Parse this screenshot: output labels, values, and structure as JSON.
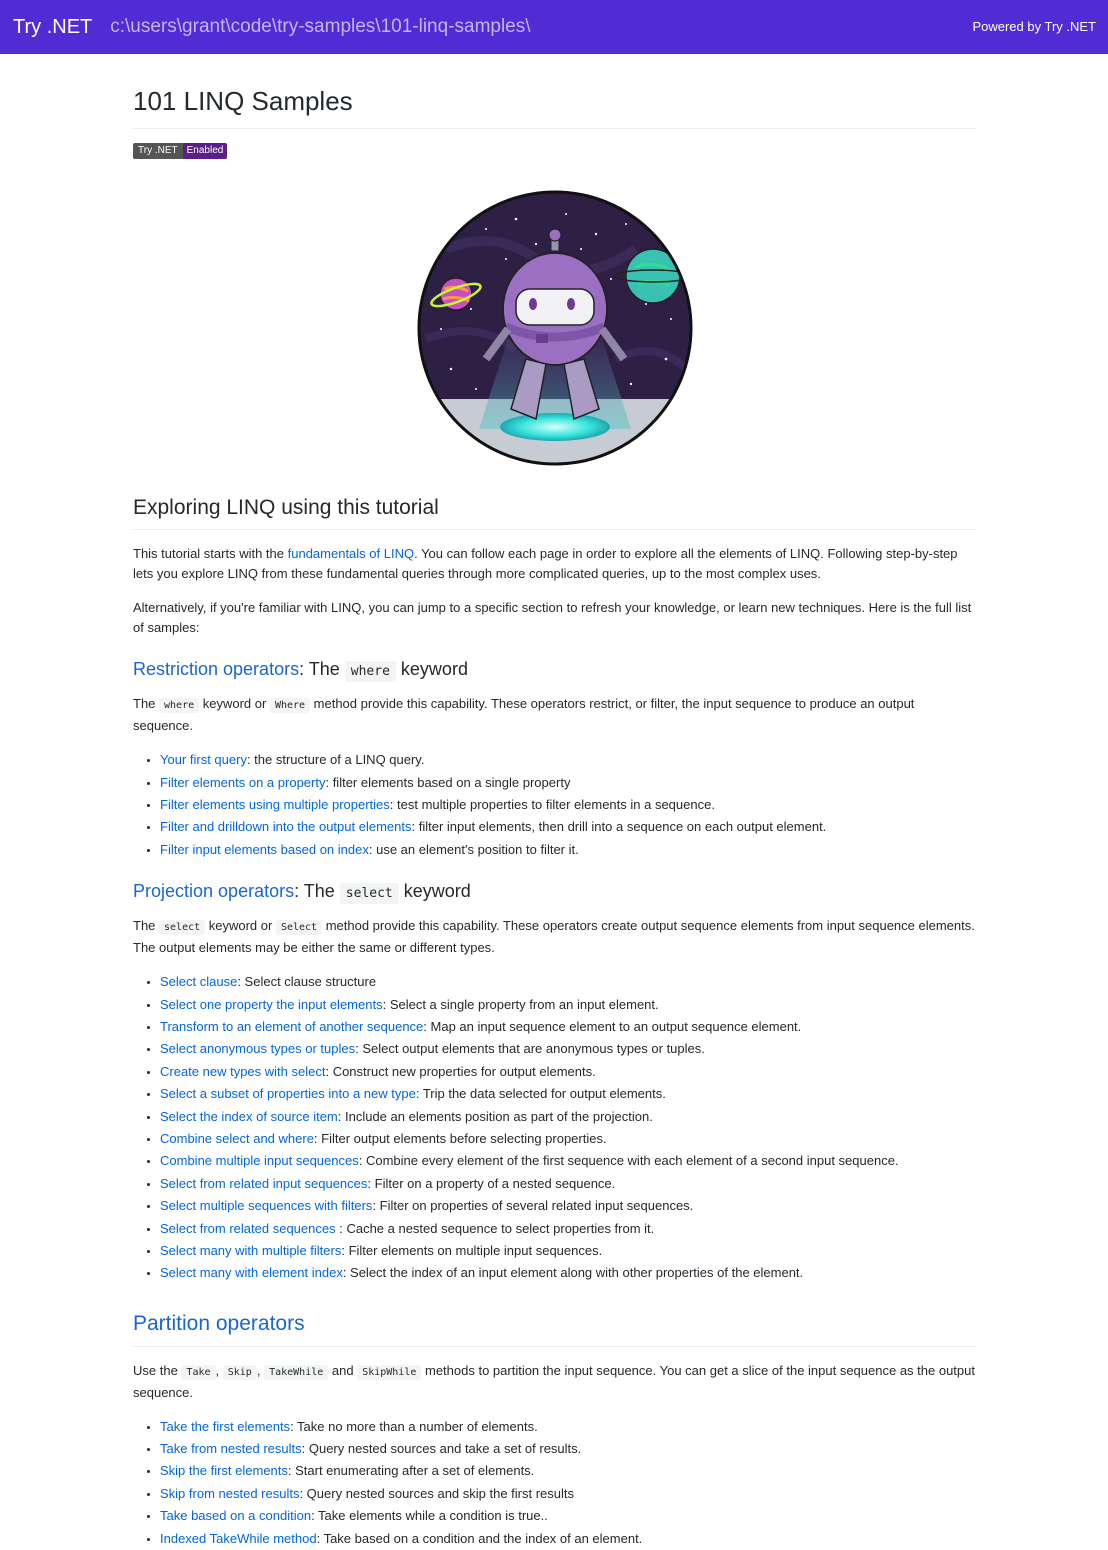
{
  "header": {
    "brand": "Try .NET",
    "path": "c:\\users\\grant\\code\\try-samples\\101-linq-samples\\",
    "powered_by": "Powered by Try .NET",
    "bg_color": "#512bd4"
  },
  "page": {
    "title": "101 LINQ Samples",
    "badge": {
      "left": "Try .NET",
      "right": "Enabled"
    },
    "hero_alt": "dotnet-bot astronaut"
  },
  "intro": {
    "heading": "Exploring LINQ using this tutorial",
    "p1_before": "This tutorial starts with the ",
    "p1_link": "fundamentals of LINQ",
    "p1_after": ". You can follow each page in order to explore all the elements of LINQ. Following step-by-step lets you explore LINQ from these fundamental queries through more complicated queries, up to the most complex uses.",
    "p2": "Alternatively, if you're familiar with LINQ, you can jump to a specific section to refresh your knowledge, or learn new techniques. Here is the full list of samples:"
  },
  "restriction": {
    "heading_link": "Restriction operators",
    "heading_mid": ": The ",
    "heading_code": "where",
    "heading_end": " keyword",
    "desc_1": "The ",
    "desc_code1": "where",
    "desc_2": " keyword or ",
    "desc_code2": "Where",
    "desc_3": " method provide this capability. These operators restrict, or filter, the input sequence to produce an output sequence.",
    "items": [
      {
        "link": "Your first query",
        "text": ": the structure of a LINQ query."
      },
      {
        "link": "Filter elements on a property",
        "text": ": filter elements based on a single property"
      },
      {
        "link": "Filter elements using multiple properties",
        "text": ": test multiple properties to filter elements in a sequence."
      },
      {
        "link": "Filter and drilldown into the output elements",
        "text": ": filter input elements, then drill into a sequence on each output element."
      },
      {
        "link": "Filter input elements based on index",
        "text": ": use an element's position to filter it."
      }
    ]
  },
  "projection": {
    "heading_link": "Projection operators",
    "heading_mid": ": The ",
    "heading_code": "select",
    "heading_end": " keyword",
    "desc_1": "The ",
    "desc_code1": "select",
    "desc_2": " keyword or ",
    "desc_code2": "Select",
    "desc_3": " method provide this capability. These operators create output sequence elements from input sequence elements. The output elements may be either the same or different types.",
    "items": [
      {
        "link": "Select clause",
        "text": ": Select clause structure"
      },
      {
        "link": "Select one property the input elements",
        "text": ": Select a single property from an input element."
      },
      {
        "link": "Transform to an element of another sequence",
        "text": ": Map an input sequence element to an output sequence element."
      },
      {
        "link": "Select anonymous types or tuples",
        "text": ": Select output elements that are anonymous types or tuples."
      },
      {
        "link": "Create new types with select",
        "text": ": Construct new properties for output elements."
      },
      {
        "link": "Select a subset of properties into a new type",
        "text": ": Trip the data selected for output elements."
      },
      {
        "link": "Select the index of source item",
        "text": ": Include an elements position as part of the projection."
      },
      {
        "link": "Combine select and where",
        "text": ": Filter output elements before selecting properties."
      },
      {
        "link": "Combine multiple input sequences",
        "text": ": Combine every element of the first sequence with each element of a second input sequence."
      },
      {
        "link": "Select from related input sequences",
        "text": ": Filter on a property of a nested sequence."
      },
      {
        "link": "Select multiple sequences with filters",
        "text": ": Filter on properties of several related input sequences."
      },
      {
        "link": "Select from related sequences",
        "text": " : Cache a nested sequence to select properties from it."
      },
      {
        "link": "Select many with multiple filters",
        "text": ": Filter elements on multiple input sequences."
      },
      {
        "link": "Select many with element index",
        "text": ": Select the index of an input element along with other properties of the element."
      }
    ]
  },
  "partition": {
    "heading": "Partition operators",
    "desc_1": "Use the ",
    "code1": "Take",
    "sep1": ", ",
    "code2": "Skip",
    "sep2": ", ",
    "code3": "TakeWhile",
    "sep3": " and ",
    "code4": "SkipWhile",
    "desc_2": " methods to partition the input sequence. You can get a slice of the input sequence as the output sequence.",
    "items": [
      {
        "link": "Take the first elements",
        "text": ": Take no more than a number of elements."
      },
      {
        "link": "Take from nested results",
        "text": ": Query nested sources and take a set of results."
      },
      {
        "link": "Skip the first elements",
        "text": ": Start enumerating after a set of elements."
      },
      {
        "link": "Skip from nested results",
        "text": ": Query nested sources and skip the first results"
      },
      {
        "link": "Take based on a condition",
        "text": ": Take elements while a condition is true.."
      },
      {
        "link": "Indexed TakeWhile method",
        "text": ": Take based on a condition and the index of an element."
      }
    ]
  }
}
